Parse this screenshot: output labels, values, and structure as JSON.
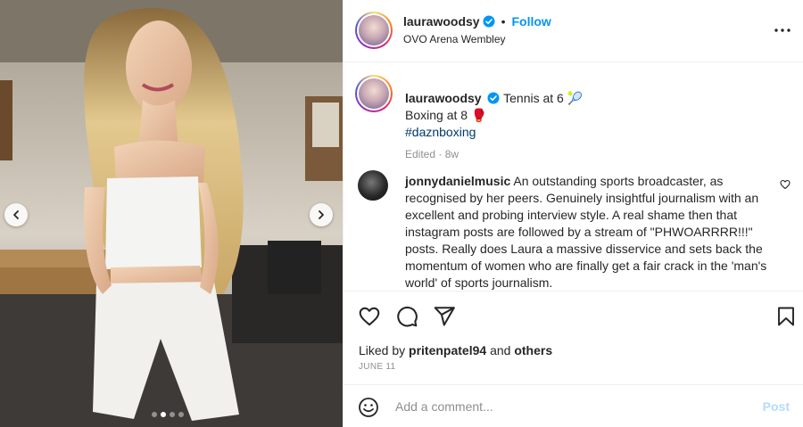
{
  "post": {
    "author": "laurawoodsy",
    "follow_label": "Follow",
    "separator": "•",
    "location": "OVO Arena Wembley"
  },
  "caption": {
    "username": "laurawoodsy",
    "line1": "Tennis at 6",
    "line1_emoji": "🎾",
    "line2": "Boxing at 8",
    "line2_emoji": "🥊",
    "hashtag": "#daznboxing",
    "edited": "Edited",
    "dot": "·",
    "age": "8w"
  },
  "comment": {
    "username": "jonnydanielmusic",
    "text": "An outstanding sports broadcaster, as recognised by her peers. Genuinely insightful journalism with an excellent and probing interview style. A real shame then that instagram posts are followed by a stream of \"PHWOARRRR!!!\" posts. Really does Laura a massive disservice and sets back the momentum of women who are finally get a fair crack in the 'man's world' of sports journalism."
  },
  "likes": {
    "prefix": "Liked by",
    "user": "pritenpatel94",
    "and": "and",
    "others": "others"
  },
  "date": "JUNE 11",
  "add_comment": {
    "placeholder": "Add a comment...",
    "post_label": "Post"
  },
  "carousel": {
    "current": 2,
    "total": 4
  },
  "icons": {
    "verified": "verified-badge-icon",
    "more": "more-options-icon",
    "like": "heart-icon",
    "comment": "comment-icon",
    "share": "share-icon",
    "save": "bookmark-icon",
    "emoji": "emoji-icon"
  },
  "colors": {
    "accent": "#0095f6",
    "verified": "#0095f6",
    "hashtag": "#00376b",
    "muted": "#8e8e8e"
  }
}
